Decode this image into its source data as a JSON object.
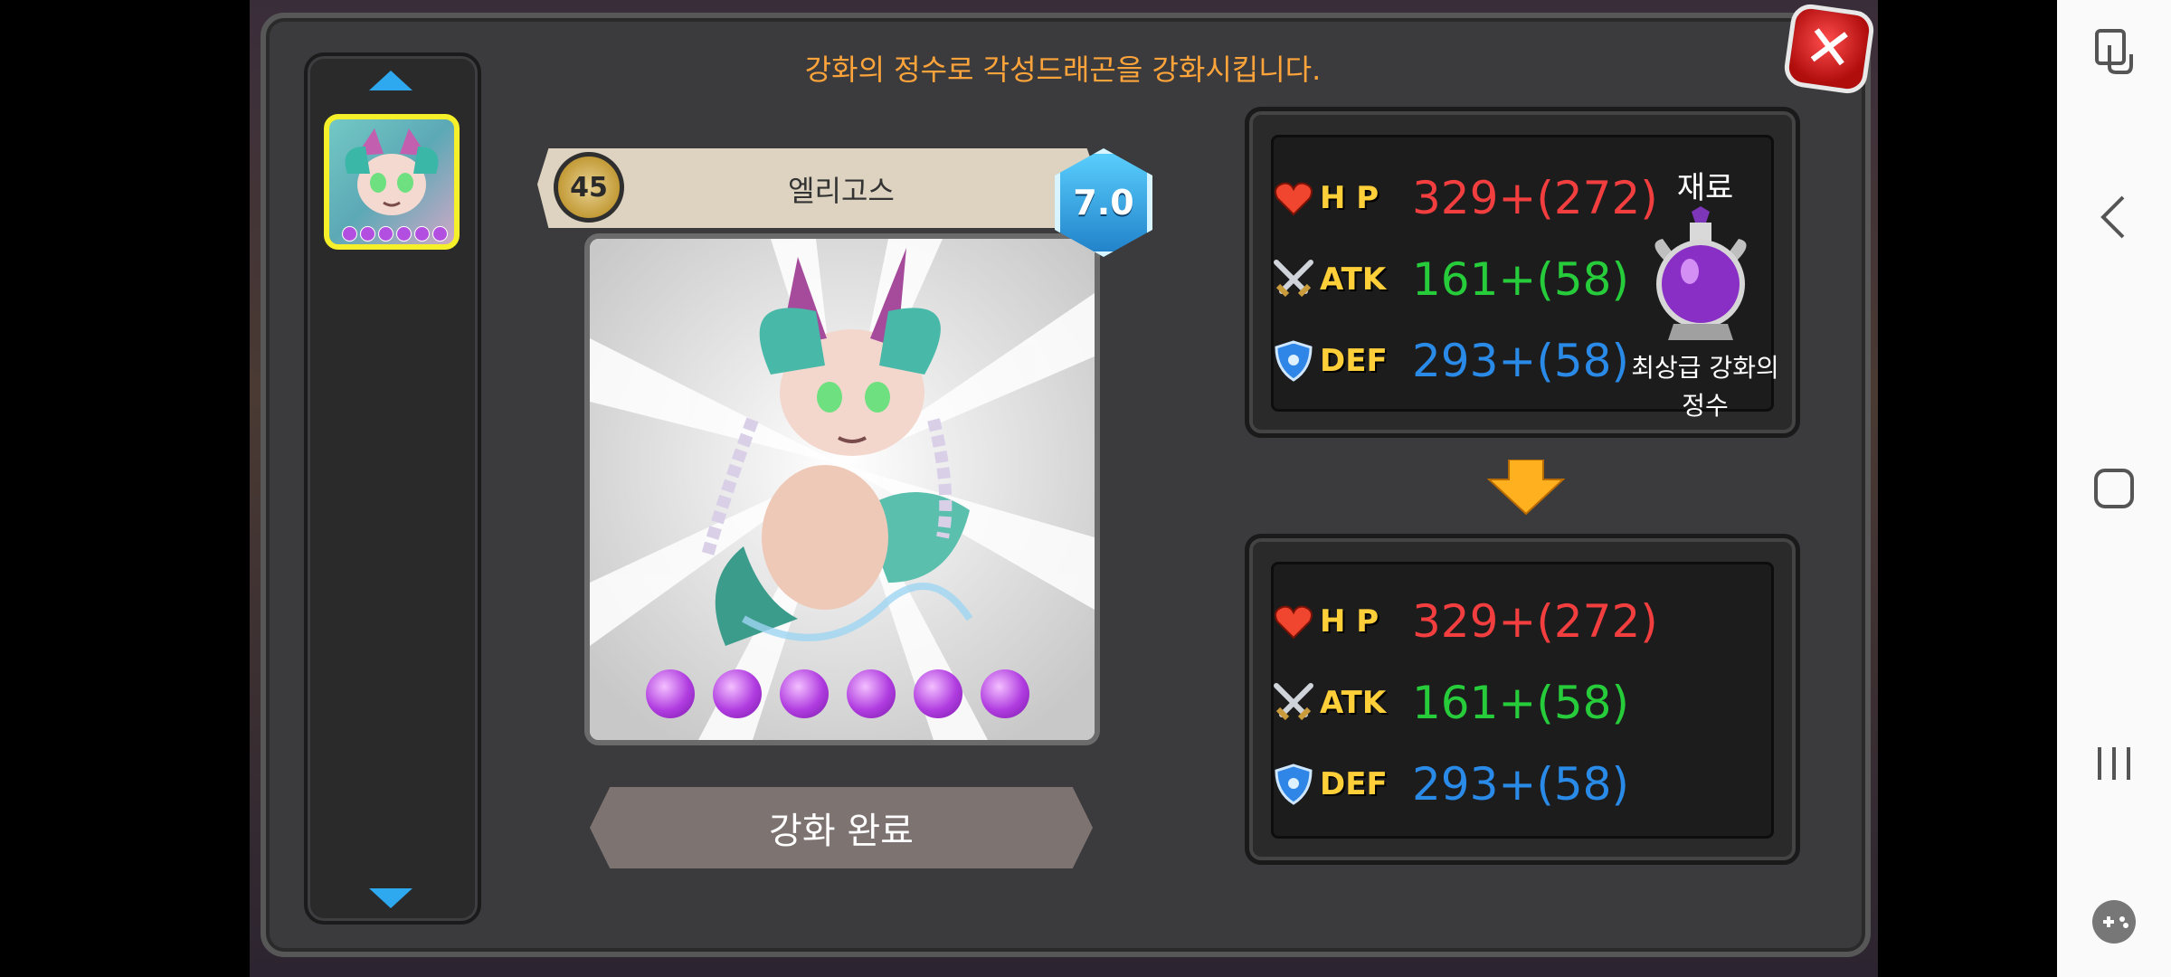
{
  "dialog": {
    "instruction": "강화의 정수로 각성드래곤을 강화시킵니다.",
    "close_label": "✕"
  },
  "dragon": {
    "name": "엘리고스",
    "level": "45",
    "grade": "7.0",
    "star_count": 6
  },
  "button": {
    "complete_label": "강화 완료"
  },
  "current_stats": {
    "hp_label": "H P",
    "hp_value": "329+(272)",
    "atk_label": "ATK",
    "atk_value": "161+(58)",
    "def_label": "DEF",
    "def_value": "293+(58)"
  },
  "result_stats": {
    "hp_label": "H P",
    "hp_value": "329+(272)",
    "atk_label": "ATK",
    "atk_value": "161+(58)",
    "def_label": "DEF",
    "def_value": "293+(58)"
  },
  "material": {
    "title": "재료",
    "name_line1": "최상급 강화의",
    "name_line2": "정수"
  },
  "colors": {
    "instruction": "#ffa43a",
    "hp": "#f23e3e",
    "atk": "#27cc3b",
    "def": "#2a8ae8",
    "stat_label": "#ffcf3a",
    "selection_border": "#f6f02a",
    "arrow": "#2ea9ef"
  }
}
